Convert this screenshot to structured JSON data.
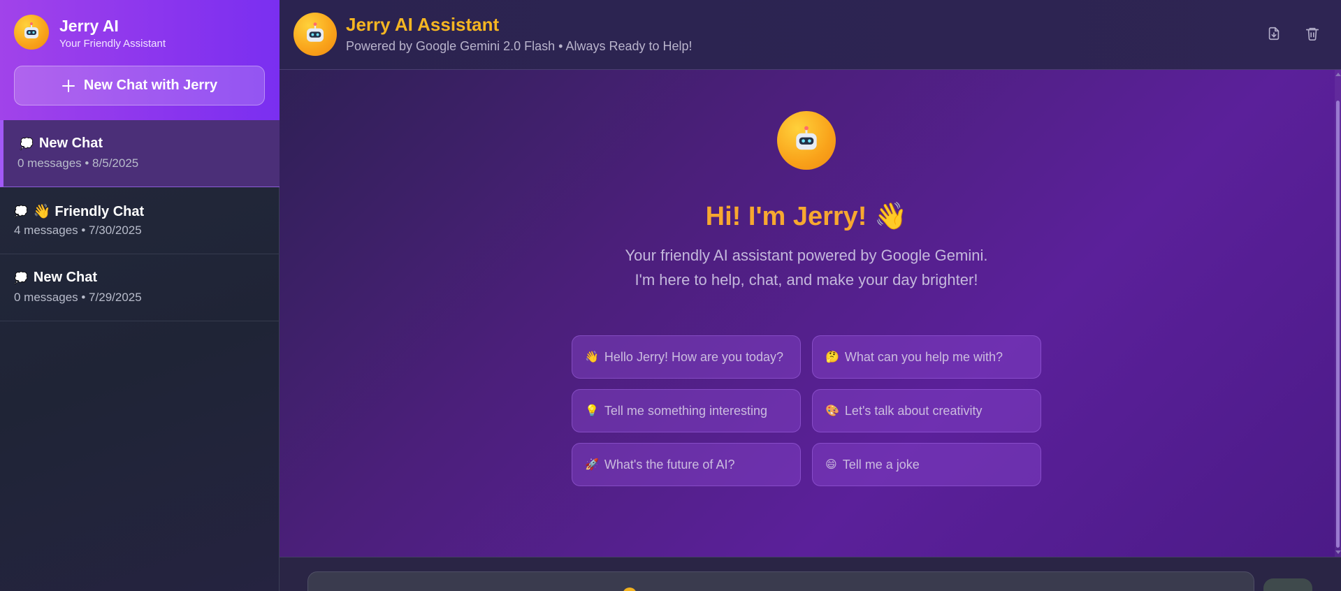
{
  "sidebar": {
    "brand_name": "Jerry AI",
    "brand_tagline": "Your Friendly Assistant",
    "new_chat_label": "New Chat with Jerry",
    "chats": [
      {
        "icon": "💭",
        "title": "New Chat",
        "meta": "0 messages • 8/5/2025",
        "active": true
      },
      {
        "icon": "💭",
        "title": "👋 Friendly Chat",
        "meta": "4 messages • 7/30/2025",
        "active": false
      },
      {
        "icon": "💭",
        "title": "New Chat",
        "meta": "0 messages • 7/29/2025",
        "active": false
      }
    ]
  },
  "header": {
    "title": "Jerry AI Assistant",
    "subtitle": "Powered by Google Gemini 2.0 Flash • Always Ready to Help!",
    "actions": [
      "export-icon",
      "trash-icon"
    ]
  },
  "welcome": {
    "title": "Hi! I'm Jerry! 👋",
    "text": "Your friendly AI assistant powered by Google Gemini. I'm here to help, chat, and make your day brighter!",
    "suggestions": [
      {
        "emoji": "👋",
        "label": "Hello Jerry! How are you today?"
      },
      {
        "emoji": "🤔",
        "label": "What can you help me with?"
      },
      {
        "emoji": "💡",
        "label": "Tell me something interesting"
      },
      {
        "emoji": "🎨",
        "label": "Let's talk about creativity"
      },
      {
        "emoji": "🚀",
        "label": "What's the future of AI?"
      },
      {
        "emoji": "😄",
        "label": "Tell me a joke"
      }
    ]
  },
  "colors": {
    "accent": "#a143ea",
    "title_gold": "#f5b622",
    "welcome_orange": "#f7a830"
  }
}
